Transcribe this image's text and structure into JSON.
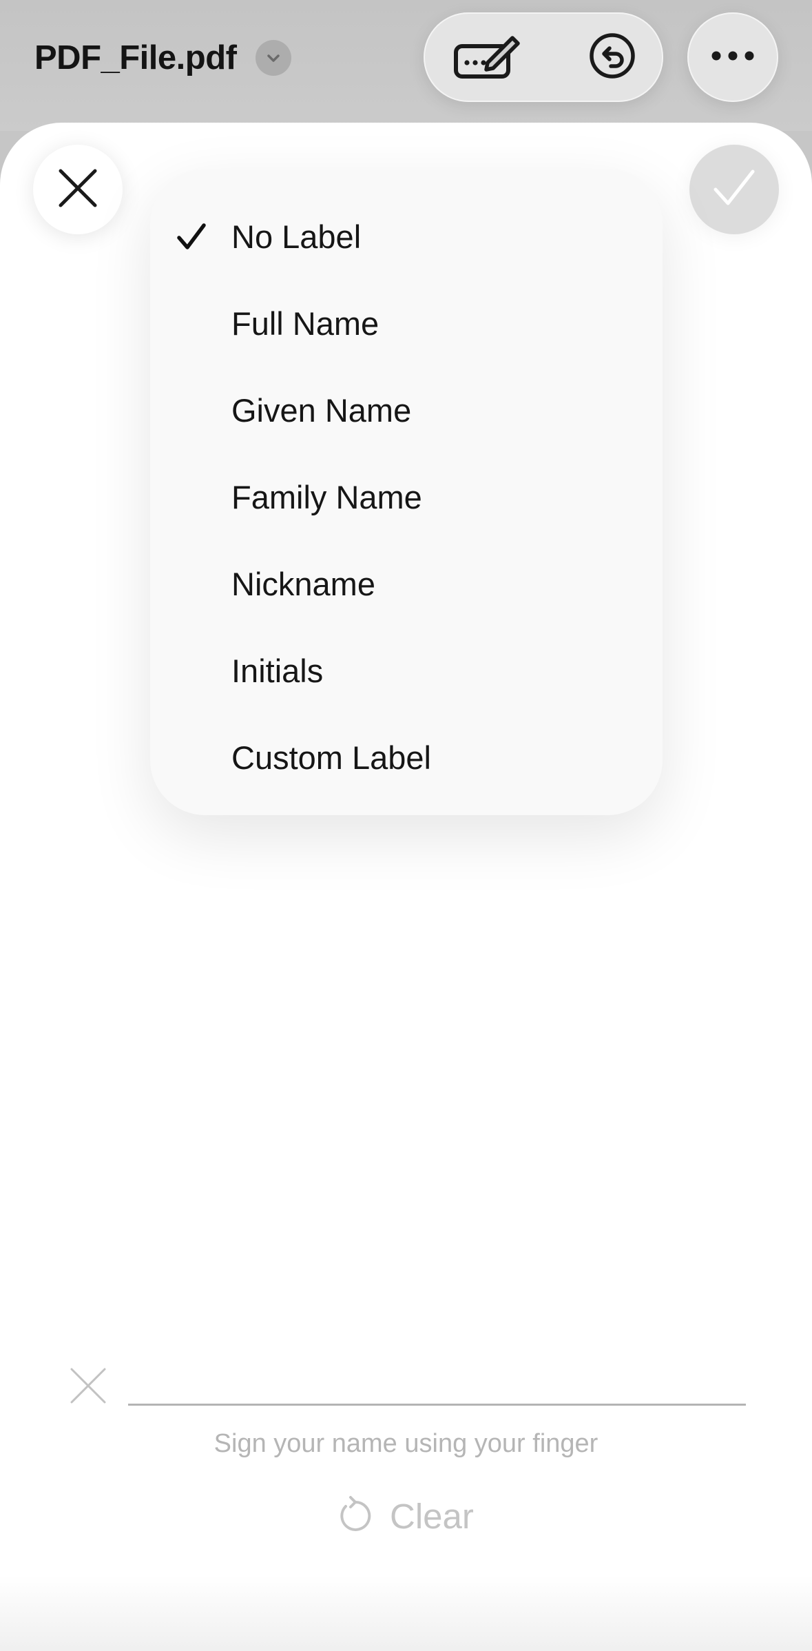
{
  "header": {
    "document_title": "PDF_File.pdf"
  },
  "menu": {
    "items": [
      {
        "label": "No Label",
        "selected": true
      },
      {
        "label": "Full Name",
        "selected": false
      },
      {
        "label": "Given Name",
        "selected": false
      },
      {
        "label": "Family Name",
        "selected": false
      },
      {
        "label": "Nickname",
        "selected": false
      },
      {
        "label": "Initials",
        "selected": false
      },
      {
        "label": "Custom Label",
        "selected": false
      }
    ]
  },
  "signature": {
    "hint": "Sign your name using your finger",
    "clear_label": "Clear"
  },
  "icons": {
    "title_menu": "chevron-down-icon",
    "markup": "signature-pen-icon",
    "undo": "undo-icon",
    "more": "ellipsis-icon",
    "close": "close-icon",
    "done": "checkmark-icon",
    "selected": "checkmark-icon",
    "signature_mark": "x-mark-icon",
    "clear": "rotate-ccw-icon"
  },
  "colors": {
    "toolbar_background": "#c6c6c6",
    "sheet_background": "#ffffff",
    "menu_background": "#f9f9f9",
    "disabled_text": "#c4c4c4"
  }
}
